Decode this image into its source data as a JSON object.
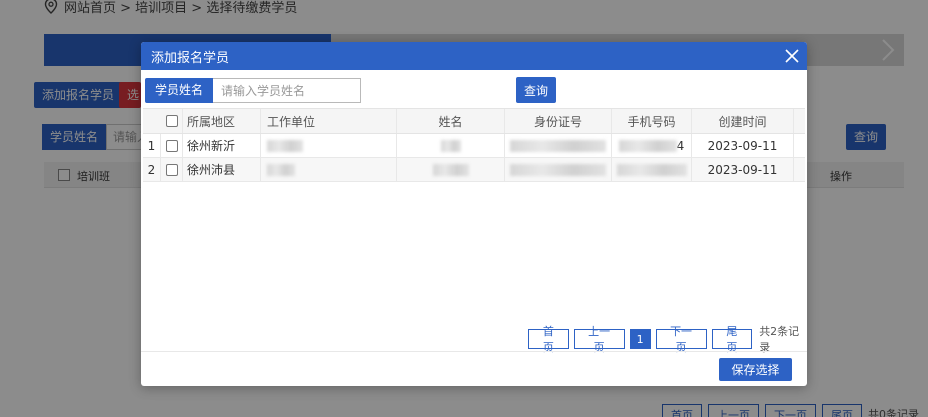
{
  "background": {
    "breadcrumb": "网站首页 > 培训项目 > 选择待缴费学员",
    "add_button": "添加报名学员",
    "select_button": "选",
    "search_label": "学员姓名",
    "search_placeholder": "请输入",
    "query_button": "查询",
    "table_head": {
      "col1": "培训班",
      "col2": "操作"
    },
    "pager": {
      "first": "首页",
      "prev": "上一页",
      "next": "下一页",
      "last": "尾页",
      "total": "共0条记录"
    }
  },
  "modal": {
    "title": "添加报名学员",
    "search": {
      "label": "学员姓名",
      "placeholder": "请输入学员姓名",
      "value": ""
    },
    "query_button": "查询",
    "columns": [
      "所属地区",
      "工作单位",
      "姓名",
      "身份证号",
      "手机号码",
      "创建时间"
    ],
    "rows": [
      {
        "index": "1",
        "region": "徐州新沂",
        "phone_tail": "4",
        "created": "2023-09-11"
      },
      {
        "index": "2",
        "region": "徐州沛县",
        "phone_tail": "",
        "created": "2023-09-11"
      }
    ],
    "pager": {
      "first": "首页",
      "prev": "上一页",
      "current": "1",
      "next": "下一页",
      "last": "尾页",
      "total": "共2条记录"
    },
    "save_button": "保存选择"
  },
  "colors": {
    "primary": "#2d62c5",
    "danger": "#d9363e",
    "step_inactive": "#d9d9d9"
  }
}
